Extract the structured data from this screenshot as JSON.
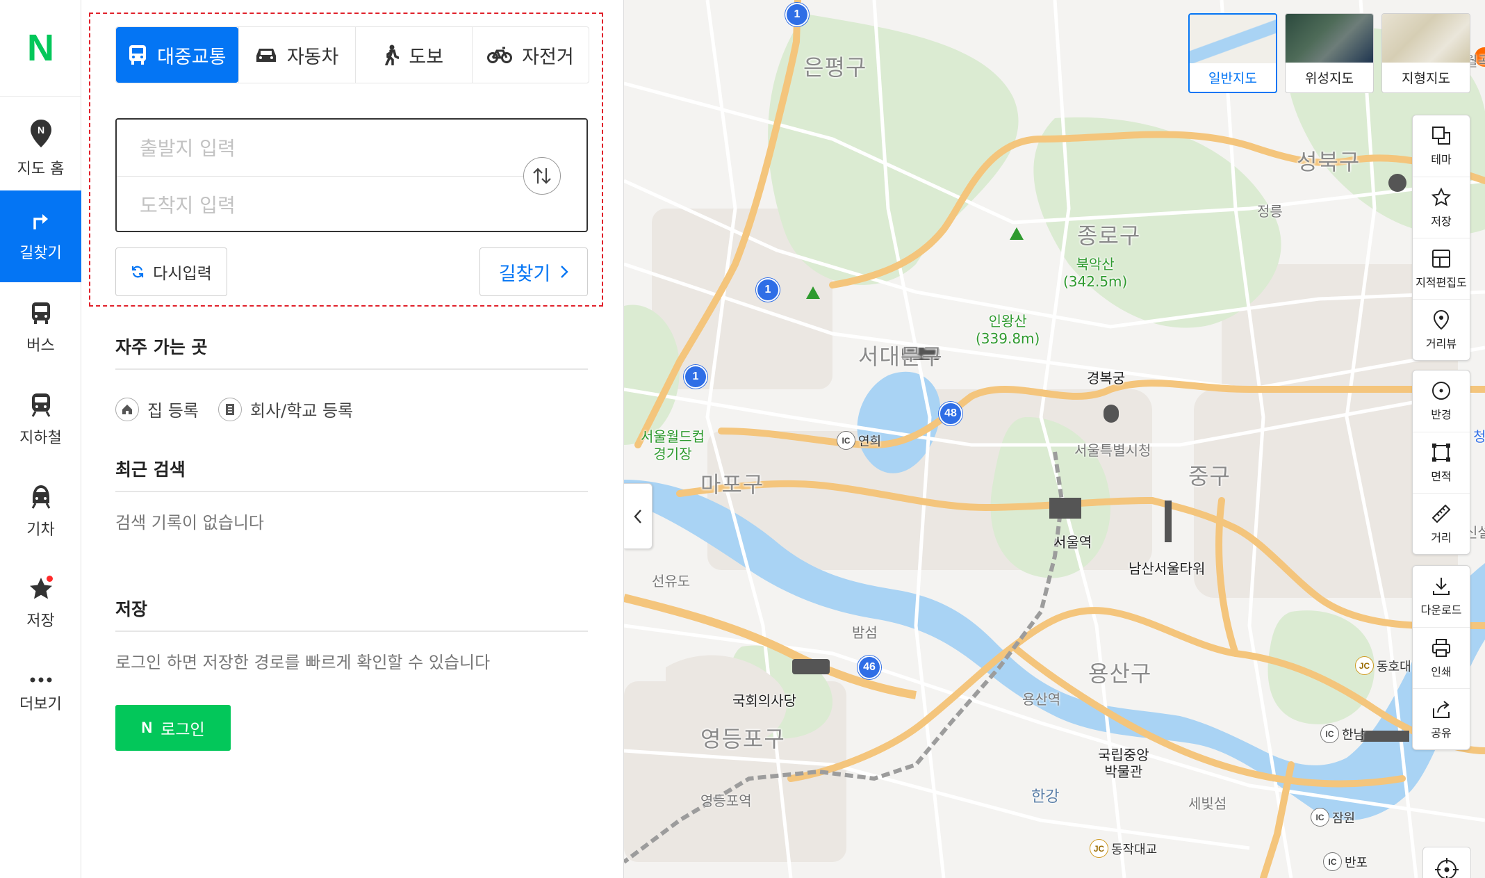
{
  "rail": {
    "logo": "N",
    "items": [
      {
        "label": "지도 홈",
        "icon": "map-pin-icon"
      },
      {
        "label": "길찾기",
        "icon": "directions-icon"
      },
      {
        "label": "버스",
        "icon": "bus-icon"
      },
      {
        "label": "지하철",
        "icon": "subway-icon"
      },
      {
        "label": "기차",
        "icon": "train-icon"
      },
      {
        "label": "저장",
        "icon": "star-icon"
      },
      {
        "label": "더보기",
        "icon": "more-icon"
      }
    ],
    "active": "길찾기"
  },
  "route": {
    "modes": [
      {
        "label": "대중교통",
        "icon": "bus-icon",
        "active": true
      },
      {
        "label": "자동차",
        "icon": "car-icon",
        "active": false
      },
      {
        "label": "도보",
        "icon": "walk-icon",
        "active": false
      },
      {
        "label": "자전거",
        "icon": "bicycle-icon",
        "active": false
      }
    ],
    "origin_placeholder": "출발지 입력",
    "destination_placeholder": "도착지 입력",
    "reset_label": "다시입력",
    "find_label": "길찾기"
  },
  "frequent": {
    "title": "자주 가는 곳",
    "home_label": "집 등록",
    "work_label": "회사/학교 등록"
  },
  "recent": {
    "title": "최근 검색",
    "empty_text": "검색 기록이 없습니다"
  },
  "saved": {
    "title": "저장",
    "hint": "로그인 하면 저장한 경로를 빠르게 확인할 수 있습니다",
    "login_logo": "N",
    "login_label": "로그인"
  },
  "map": {
    "types": [
      {
        "label": "일반지도",
        "active": true
      },
      {
        "label": "위성지도",
        "active": false
      },
      {
        "label": "지형지도",
        "active": false
      }
    ],
    "tools_group1": [
      "테마",
      "저장",
      "지적편집도",
      "거리뷰"
    ],
    "tools_group2": [
      "반경",
      "면적",
      "거리"
    ],
    "tools_group3": [
      "다운로드",
      "인쇄",
      "공유"
    ],
    "districts": {
      "eunpyeong": "은평구",
      "seongbuk": "성북구",
      "jongno": "종로구",
      "seodaemun": "서대문구",
      "mapo": "마포구",
      "jung": "중구",
      "yongsan": "용산구",
      "yeongdeungpo": "영등포구"
    },
    "pois": {
      "jeongneung": "정릉",
      "bukaksan": "북악산",
      "bukaksan_height": "(342.5m)",
      "inwangsan": "인왕산",
      "inwangsan_height": "(339.8m)",
      "gyeongbokgung": "경복궁",
      "cityhall": "서울특별시청",
      "worldcup1": "서울월드컵",
      "worldcup2": "경기장",
      "seoul_station": "서울역",
      "namsan_tower": "남산서울타워",
      "national_assembly": "국회의사당",
      "museum1": "국립중앙",
      "museum2": "박물관",
      "yongsan_station": "용산역",
      "yeongdeungpo_station": "영등포역",
      "seonyudo": "선유도",
      "bamseom": "밤섬",
      "hangang": "한강",
      "sebitseom": "세빛섬"
    },
    "interchanges": {
      "yeonhui": "연희",
      "dongho": "동호대",
      "hannam": "한남",
      "jamwon": "잠원",
      "banpo": "반포",
      "dongjak": "동작대교"
    },
    "routes": [
      "1",
      "1",
      "1",
      "48",
      "46"
    ],
    "ic_code": "IC",
    "jc_code": "JC",
    "edge_text": "청",
    "edge_text2": "월곡",
    "edge_text3": "신설"
  }
}
